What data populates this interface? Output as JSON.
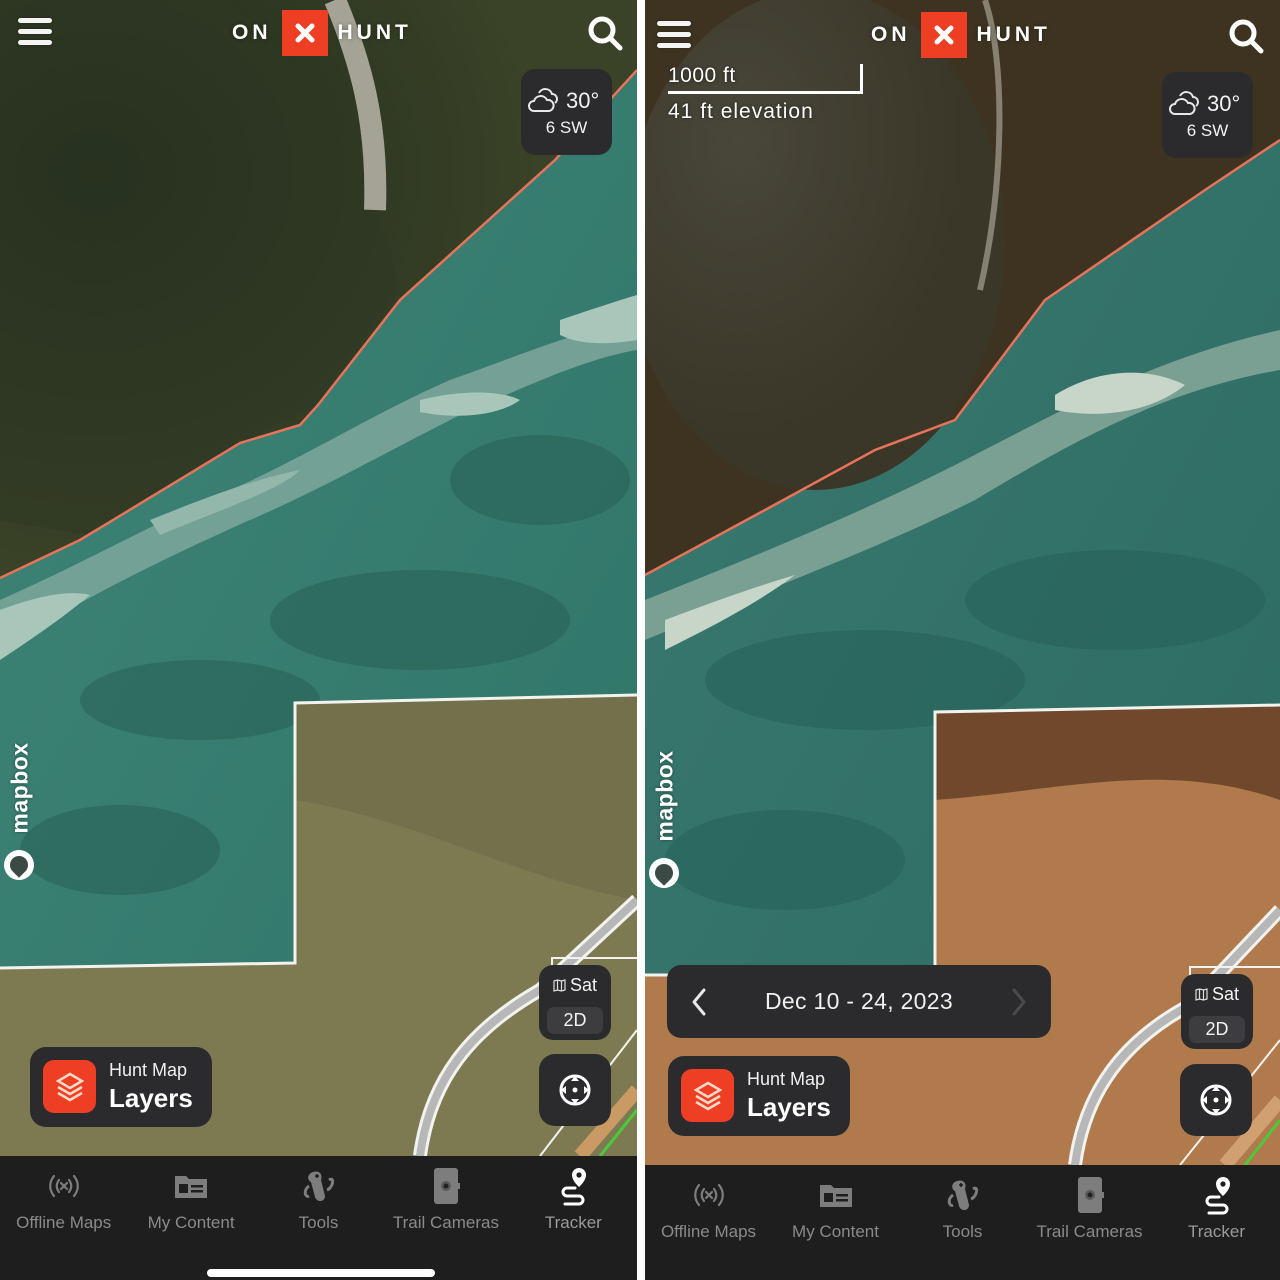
{
  "app": {
    "logo_left": "ON",
    "logo_right": "HUNT",
    "brand_color": "#ee3e23"
  },
  "panels": [
    {
      "id": "left",
      "weather": {
        "temperature": "30°",
        "wind": "6 SW",
        "icon": "cloudy-icon"
      },
      "map_style": {
        "style_label": "Sat",
        "dimension_label": "2D"
      },
      "layers": {
        "subtitle": "Hunt Map",
        "title": "Layers"
      },
      "attribution": "mapbox"
    },
    {
      "id": "right",
      "scale": {
        "distance": "1000 ft",
        "elevation": "41 ft elevation"
      },
      "weather": {
        "temperature": "30°",
        "wind": "6 SW",
        "icon": "cloudy-icon"
      },
      "map_style": {
        "style_label": "Sat",
        "dimension_label": "2D"
      },
      "date_range": {
        "label": "Dec 10 - 24, 2023",
        "prev_enabled": true,
        "next_enabled": false
      },
      "layers": {
        "subtitle": "Hunt Map",
        "title": "Layers"
      },
      "attribution": "mapbox"
    }
  ],
  "nav": [
    {
      "label": "Offline Maps",
      "icon": "offline-signal-icon"
    },
    {
      "label": "My Content",
      "icon": "folder-icon"
    },
    {
      "label": "Tools",
      "icon": "multitool-icon"
    },
    {
      "label": "Trail Cameras",
      "icon": "trail-camera-icon"
    },
    {
      "label": "Tracker",
      "icon": "route-pin-icon",
      "active": true
    }
  ],
  "colors": {
    "control_bg": "#2b2b2d",
    "nav_bg": "#1e1e1e",
    "nav_label": "#8a8a8a",
    "public_land_boundary": "#e8735b",
    "parcel_boundary": "#f2f2ee",
    "trail_green": "#4cc93a"
  }
}
